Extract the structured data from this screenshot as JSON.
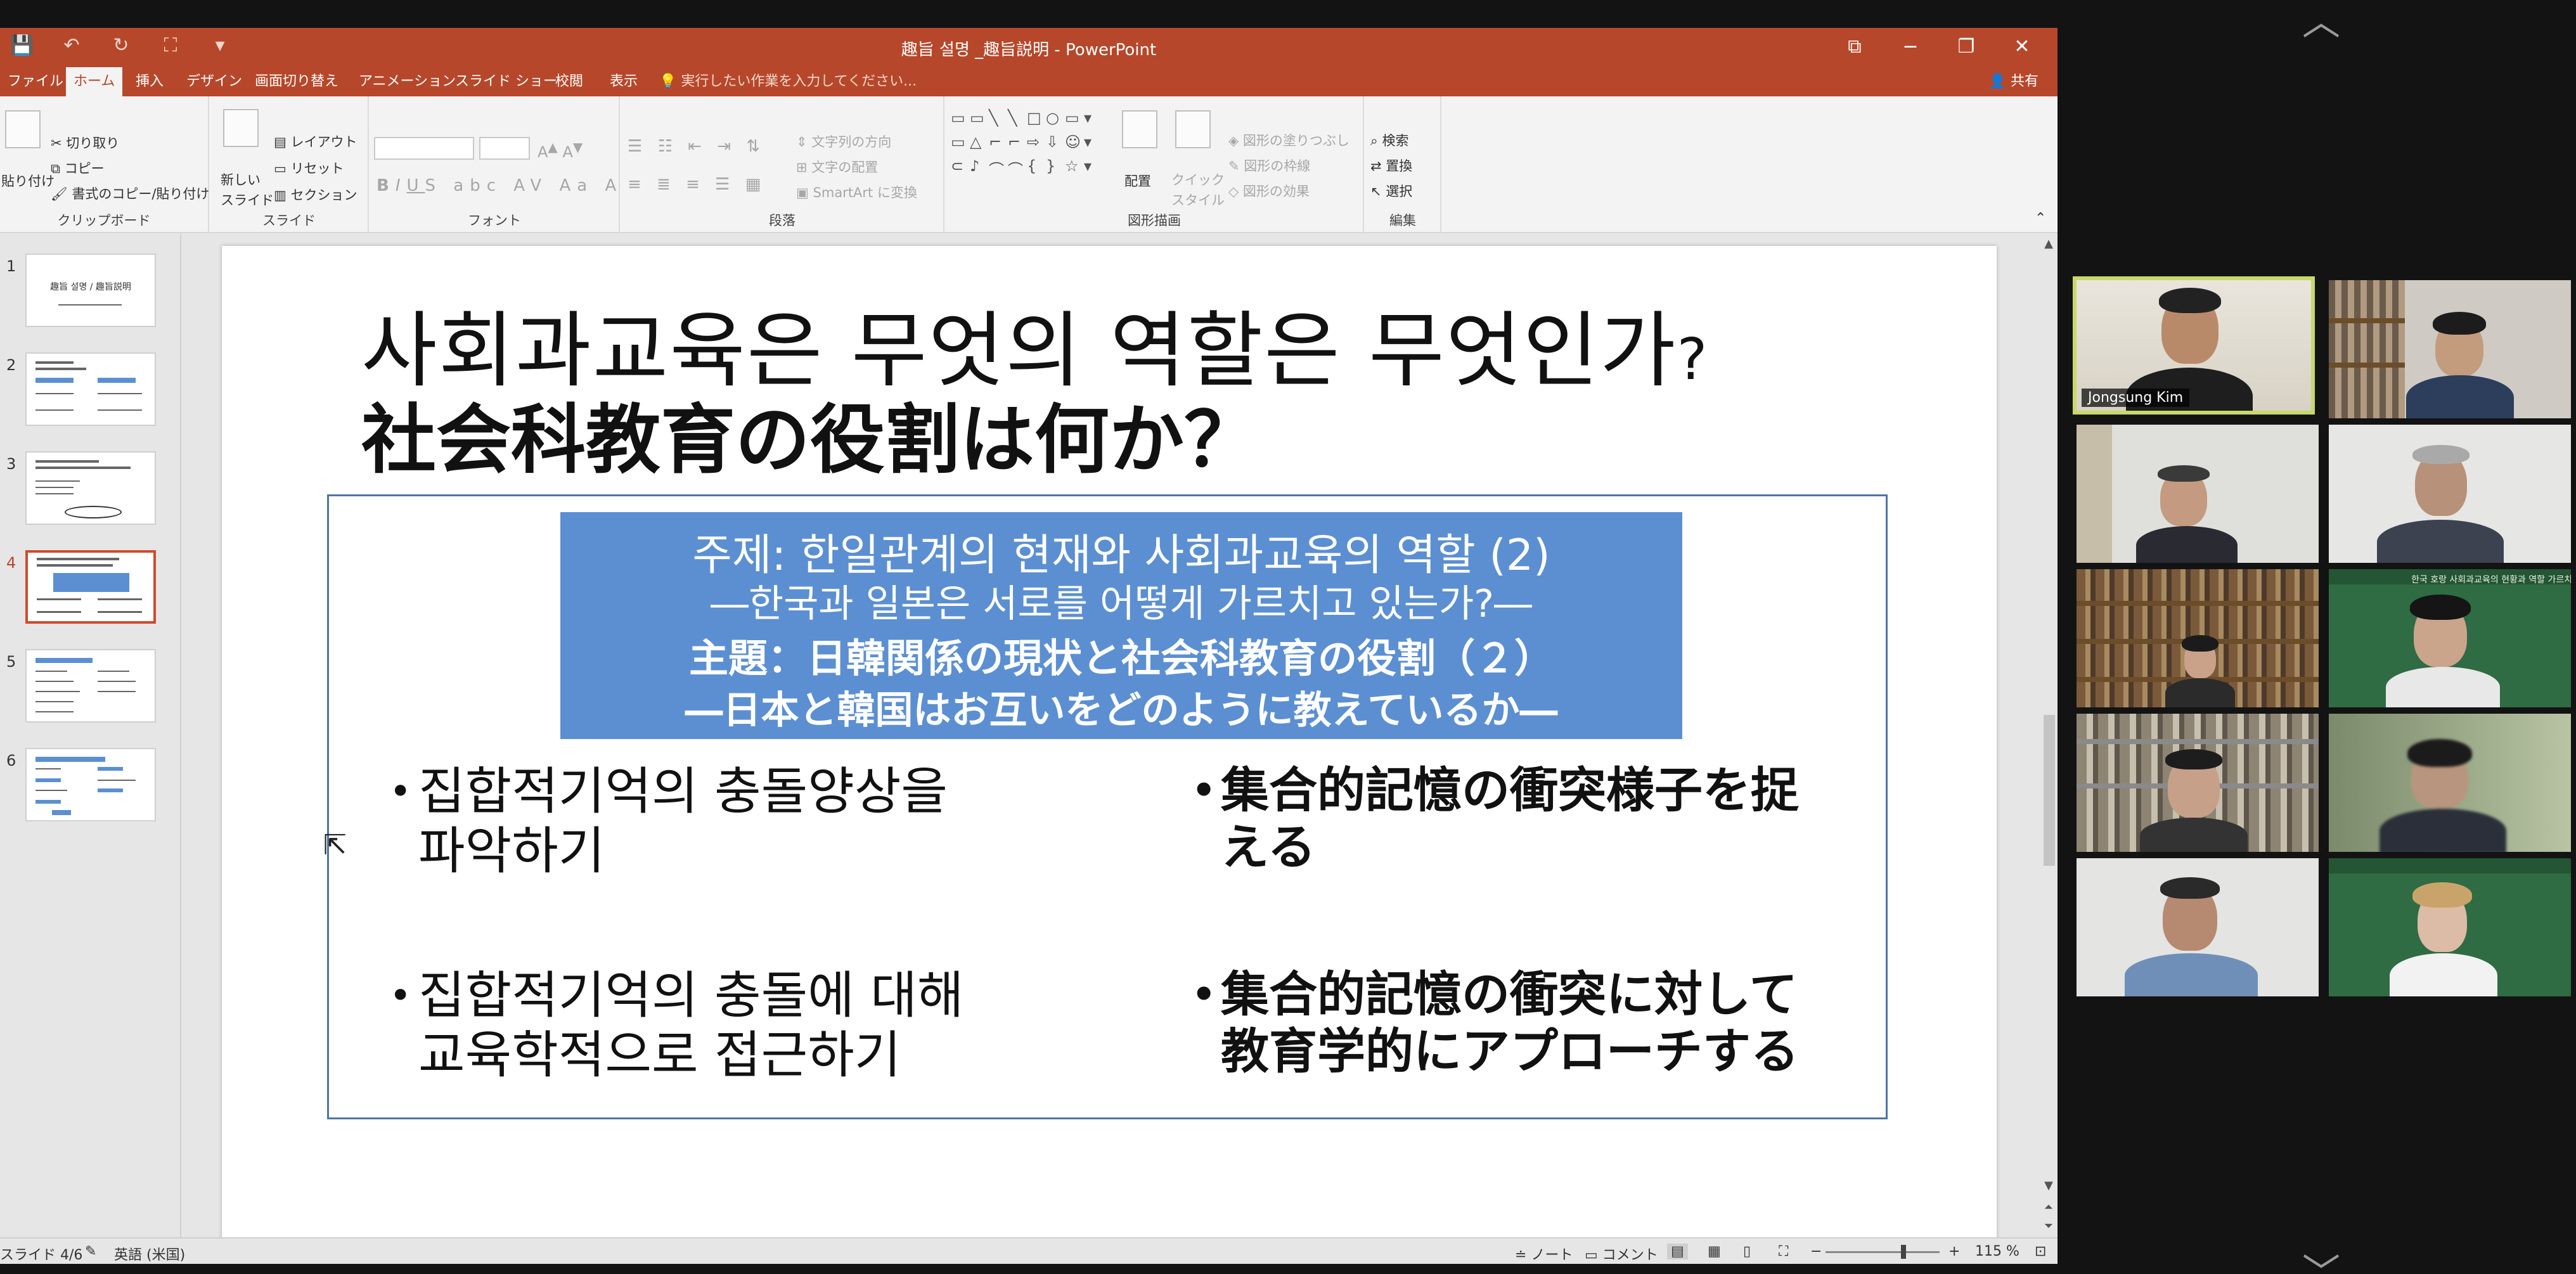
{
  "app": {
    "window_title": "趣旨 설명 _趣旨説明 - PowerPoint",
    "share_label": "共有",
    "tell_me": "実行したい作業を入力してください...",
    "tabs": [
      {
        "label": "ファイル",
        "active": false
      },
      {
        "label": "ホーム",
        "active": true
      },
      {
        "label": "挿入",
        "active": false
      },
      {
        "label": "デザイン",
        "active": false
      },
      {
        "label": "画面切り替え",
        "active": false
      },
      {
        "label": "アニメーション",
        "active": false
      },
      {
        "label": "スライド ショー",
        "active": false
      },
      {
        "label": "校閲",
        "active": false
      },
      {
        "label": "表示",
        "active": false
      }
    ]
  },
  "ribbon": {
    "clipboard": {
      "label": "クリップボード",
      "paste": "貼り付け",
      "cut": "切り取り",
      "copy": "コピー",
      "format_painter": "書式のコピー/貼り付け"
    },
    "slides": {
      "label": "スライド",
      "new_slide": "新しい\nスライド",
      "layout": "レイアウト",
      "reset": "リセット",
      "section": "セクション"
    },
    "font": {
      "label": "フォント"
    },
    "paragraph": {
      "label": "段落",
      "text_direction": "文字列の方向",
      "align_text": "文字の配置",
      "smartart": "SmartArt に変換"
    },
    "drawing": {
      "label": "図形描画",
      "arrange": "配置",
      "quick_styles": "クイック\nスタイル",
      "shape_fill": "図形の塗りつぶし",
      "shape_outline": "図形の枠線",
      "shape_effects": "図形の効果"
    },
    "editing": {
      "label": "編集",
      "find": "検索",
      "replace": "置換",
      "select": "選択"
    }
  },
  "thumbnails": [
    {
      "num": "1",
      "active": false,
      "title": "趣旨 설명 / 趣旨説明"
    },
    {
      "num": "2",
      "active": false,
      "title": ""
    },
    {
      "num": "3",
      "active": false,
      "title": ""
    },
    {
      "num": "4",
      "active": true,
      "title": ""
    },
    {
      "num": "5",
      "active": false,
      "title": ""
    },
    {
      "num": "6",
      "active": false,
      "title": ""
    }
  ],
  "slide": {
    "title_ko": "사회과교육은 무엇의 역할은 무엇인가",
    "title_ko_q": "?",
    "title_ja": "社会科教育の役割は何か？",
    "topic_lines": [
      "주제: 한일관계의 현재와 사회과교육의 역할 (2)",
      "―한국과 일본은 서로를 어떻게 가르치고 있는가?―",
      "主題：日韓関係の現状と社会科教育の役割（２）",
      "―日本と韓国はお互いをどのように教えているか―"
    ],
    "bullets": [
      {
        "lang": "ko",
        "lines": [
          "집합적기억의 충돌양상을",
          "파악하기"
        ]
      },
      {
        "lang": "ja",
        "lines": [
          "集合的記憶の衝突様子を捉",
          "える"
        ]
      },
      {
        "lang": "ko",
        "lines": [
          "집합적기억의 충돌에 대해",
          "교육학적으로 접근하기"
        ]
      },
      {
        "lang": "ja",
        "lines": [
          "集合的記憶の衝突に対して",
          "教育学的にアプローチする"
        ]
      }
    ]
  },
  "status": {
    "slide_pos": "スライド 4/6",
    "language": "英語 (米国)",
    "notes": "ノート",
    "comments": "コメント",
    "zoom": "115 %",
    "zoom_minus": "−",
    "zoom_plus": "+"
  },
  "gallery": {
    "speaker_name": "Jongsung Kim",
    "board_text": "한국 호랑 사회과교육의 현황과 역할 가르치는가"
  },
  "colors": {
    "ppt_accent": "#b7472a",
    "topic_box": "#5b8fd2",
    "speaker_border": "#c8d96b"
  }
}
